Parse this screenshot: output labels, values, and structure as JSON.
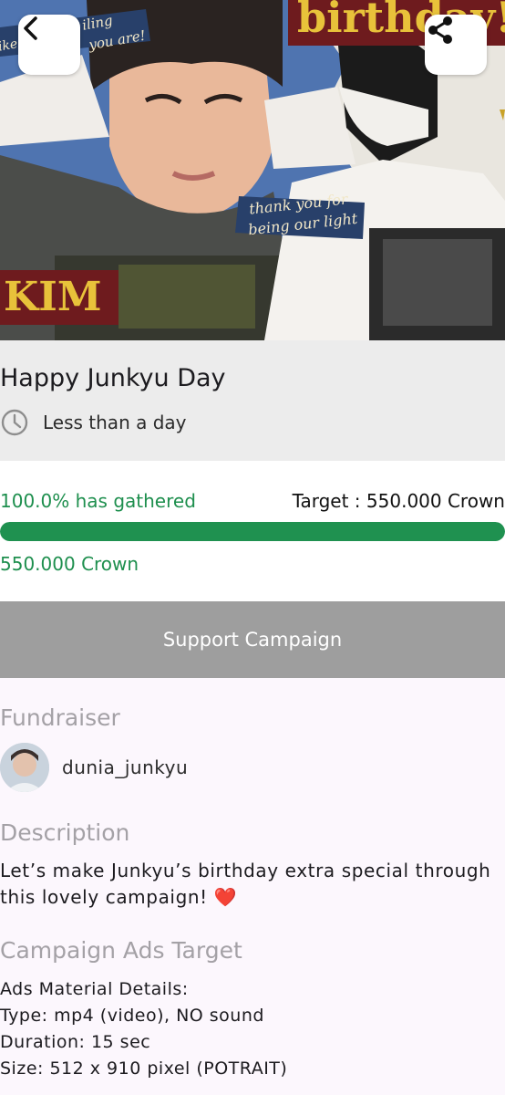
{
  "hero": {
    "banner_text_top": "birthday!",
    "banner_text_bottom": "KIM",
    "script_line_1": "iling",
    "script_line_1b": "you are!",
    "script_line_1c": "ike",
    "script_line_2": "thank you for",
    "script_line_2b": "being our light",
    "back_icon": "chevron-left-icon",
    "share_icon": "share-icon"
  },
  "campaign": {
    "title": "Happy Junkyu Day",
    "time_left": "Less than a day",
    "clock_icon": "clock-icon"
  },
  "progress": {
    "gathered_label": "100.0% has gathered",
    "target_label": "Target : 550.000 Crown",
    "raised_label": "550.000 Crown",
    "fraction": 1.0
  },
  "support_button": {
    "label": "Support Campaign"
  },
  "fundraiser": {
    "heading": "Fundraiser",
    "username": "dunia_junkyu"
  },
  "description": {
    "heading": "Description",
    "text": "Let’s make Junkyu’s birthday extra special through this lovely campaign!",
    "emoji": "❤️"
  },
  "ads_target": {
    "heading": "Campaign Ads Target",
    "lines": [
      "Ads Material Details:",
      "Type: mp4 (video), NO sound",
      "Duration: 15 sec",
      "Size: 512 x 910 pixel (POTRAIT)"
    ]
  },
  "colors": {
    "accent_green": "#1f9150",
    "button_gray": "#9e9e9e",
    "heading_gray": "#a4a1a6",
    "banner_maroon": "#6e1b1e",
    "banner_gold": "#e8c23a"
  }
}
